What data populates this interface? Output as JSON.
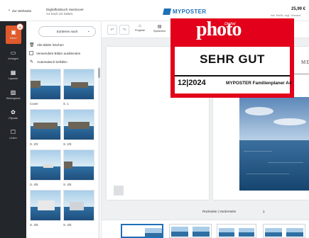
{
  "header": {
    "back_label": "Zur Webseite",
    "project_title": "Digitalfotobuch Hardcover",
    "project_sub": "A4 hoch 24 Seiten",
    "logo_text": "MYPOSTER",
    "price": "25,99 €",
    "price_sub": "inkl. MwSt. zzgl. Versand"
  },
  "rail": {
    "badge_count": "36",
    "items": [
      {
        "label": "Bilder",
        "icon": "image-icon"
      },
      {
        "label": "Vorlagen",
        "icon": "templates-icon"
      },
      {
        "label": "Layouts",
        "icon": "layouts-icon"
      },
      {
        "label": "Hintergrund",
        "icon": "background-icon"
      },
      {
        "label": "Cliparts",
        "icon": "cliparts-icon"
      },
      {
        "label": "Linien",
        "icon": "lines-icon"
      }
    ]
  },
  "panel": {
    "sort_label": "Sortieren nach",
    "options": {
      "delete_all": "Alle Bilder löschen",
      "hide_used": "Verwendete Bilder ausblenden",
      "autofill": "Automatisch befüllen"
    },
    "thumbs": [
      {
        "caption": "Cover"
      },
      {
        "caption": "S. 1"
      },
      {
        "caption": "S. 2/3"
      },
      {
        "caption": "S. 2/3"
      },
      {
        "caption": "S. 4/5"
      },
      {
        "caption": "S. 4/5"
      },
      {
        "caption": "S. 4/5"
      },
      {
        "caption": "S. 4/5"
      }
    ]
  },
  "toolbar": {
    "undo": "↶",
    "redo": "↷",
    "tools": [
      {
        "label": "Projekte",
        "icon": "folder-icon"
      },
      {
        "label": "Speichern",
        "icon": "save-icon"
      }
    ]
  },
  "editor": {
    "calendar_title": "MENT",
    "pager_label": "Rückseite | Vorderseite",
    "next": "›"
  },
  "badge": {
    "digital": "Digital",
    "brand": "photo",
    "rating": "SEHR GUT",
    "issue": "12|2024",
    "product": "MYPOSTER Familienplaner A4"
  },
  "colors": {
    "accent": "#e05a2b",
    "brand_blue": "#1e6fb8",
    "badge_red": "#e2001a",
    "rail_bg": "#23262b"
  }
}
